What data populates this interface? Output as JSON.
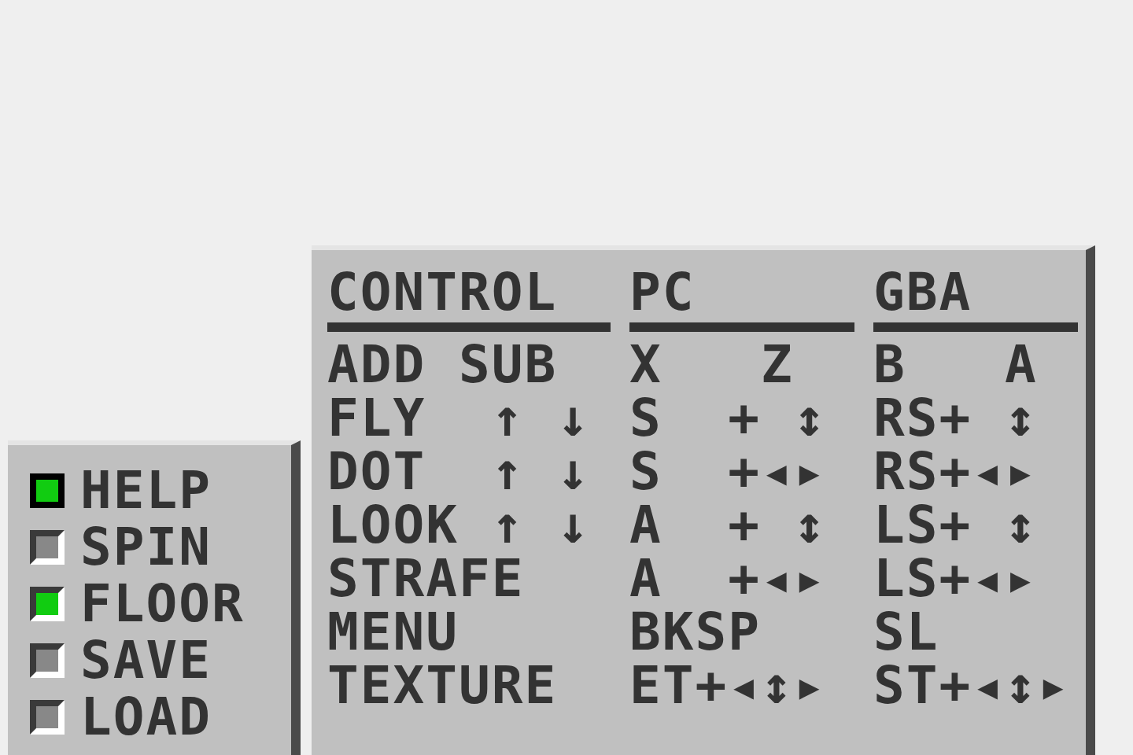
{
  "options": [
    {
      "label": "HELP",
      "checked": true,
      "selected": true
    },
    {
      "label": "SPIN",
      "checked": false,
      "selected": false
    },
    {
      "label": "FLOOR",
      "checked": true,
      "selected": false
    },
    {
      "label": "SAVE",
      "checked": false,
      "selected": false
    },
    {
      "label": "LOAD",
      "checked": false,
      "selected": false
    }
  ],
  "controls": {
    "columns": [
      "CONTROL",
      "PC",
      "GBA"
    ],
    "rows": [
      [
        "ADD SUB",
        "X   Z",
        "B   A"
      ],
      [
        "FLY  ↑ ↓",
        "S  + ↕",
        "RS+ ↕"
      ],
      [
        "DOT  ↑ ↓",
        "S  +◂▸",
        "RS+◂▸"
      ],
      [
        "LOOK ↑ ↓",
        "A  + ↕",
        "LS+ ↕"
      ],
      [
        "STRAFE",
        "A  +◂▸",
        "LS+◂▸"
      ],
      [
        "MENU",
        "BKSP",
        "SL"
      ],
      [
        "TEXTURE",
        "ET+◂↕▸",
        "ST+◂↕▸"
      ]
    ]
  }
}
